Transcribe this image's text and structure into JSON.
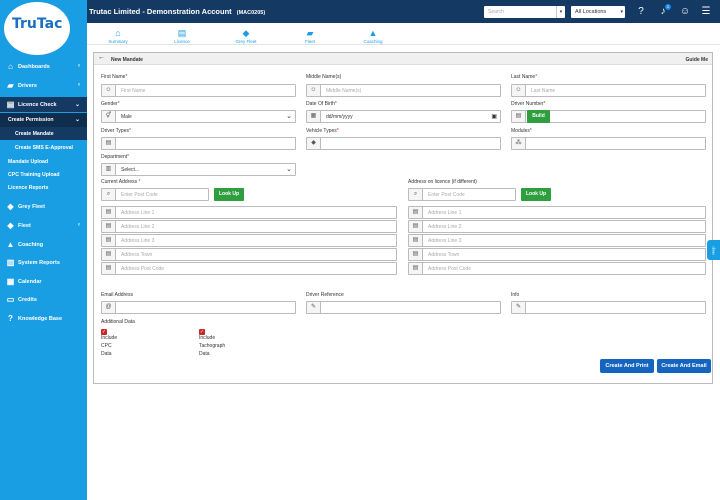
{
  "header": {
    "title": "Trutac Limited - Demonstration Account",
    "account_code": "(MAC0205)",
    "search_placeholder": "Search",
    "location_label": "All Locations",
    "notification_count": "2"
  },
  "logo": {
    "text": "TruTac"
  },
  "sidebar": {
    "dashboards": "Dashboards",
    "drivers": "Drivers",
    "licence_check": "Licence Check",
    "create_permission": "Create Permission",
    "create_mandate": "Create Mandate",
    "create_sms": "Create SMS E-Approval",
    "mandate_upload": "Mandate Upload",
    "cpc_training_upload": "CPC Training Upload",
    "licence_reports": "Licence Reports",
    "grey_fleet": "Grey Fleet",
    "fleet": "Fleet",
    "coaching": "Coaching",
    "system_reports": "System Reports",
    "calendar": "Calendar",
    "credits": "Credits",
    "knowledge_base": "Knowledge Base"
  },
  "nav_tabs": {
    "summary": "Summary",
    "licence": "Licence",
    "grey_fleet": "Grey Fleet",
    "fleet": "Fleet",
    "coaching": "Coaching"
  },
  "panel": {
    "title": "New Mandate",
    "guide": "Guide Me"
  },
  "form": {
    "first_name_label": "First Name",
    "first_name_placeholder": "First Name",
    "middle_name_label": "Middle Name(s)",
    "middle_name_placeholder": "Middle Name(s)",
    "last_name_label": "Last Name",
    "last_name_placeholder": "Last Name",
    "gender_label": "Gender",
    "gender_value": "Male",
    "dob_label": "Date Of Birth",
    "dob_placeholder": "dd/mm/yyyy",
    "driver_number_label": "Driver Number",
    "build_button": "Build",
    "driver_types_label": "Driver Types",
    "vehicle_types_label": "Vehicle Types",
    "modules_label": "Modules",
    "department_label": "Department",
    "department_value": "Select...",
    "current_address_label": "Current Address",
    "licence_address_label": "Address on licence (if different)",
    "postcode_placeholder": "Enter Post Code",
    "lookup_button": "Look Up",
    "address_line_1": "Address Line 1",
    "address_line_2": "Address Line 2",
    "address_line_3": "Address Line 3",
    "address_town": "Address Town",
    "address_postcode": "Address Post Code",
    "email_label": "Email Address",
    "driver_reference_label": "Driver Reference",
    "info_label": "Info",
    "additional_data_label": "Additional Data",
    "include_cpc": [
      "Include",
      "CPC",
      "Data"
    ],
    "include_tacho": [
      "Include",
      "Tachograph",
      "Data"
    ],
    "create_print_button": "Create And Print",
    "create_email_button": "Create And Email"
  },
  "help_tab": "Help",
  "colors": {
    "topbar": "#143a63",
    "sidebar": "#1a9ee3",
    "green": "#2e9e3f",
    "blue_button": "#1565c0",
    "checkbox": "#c62828"
  }
}
